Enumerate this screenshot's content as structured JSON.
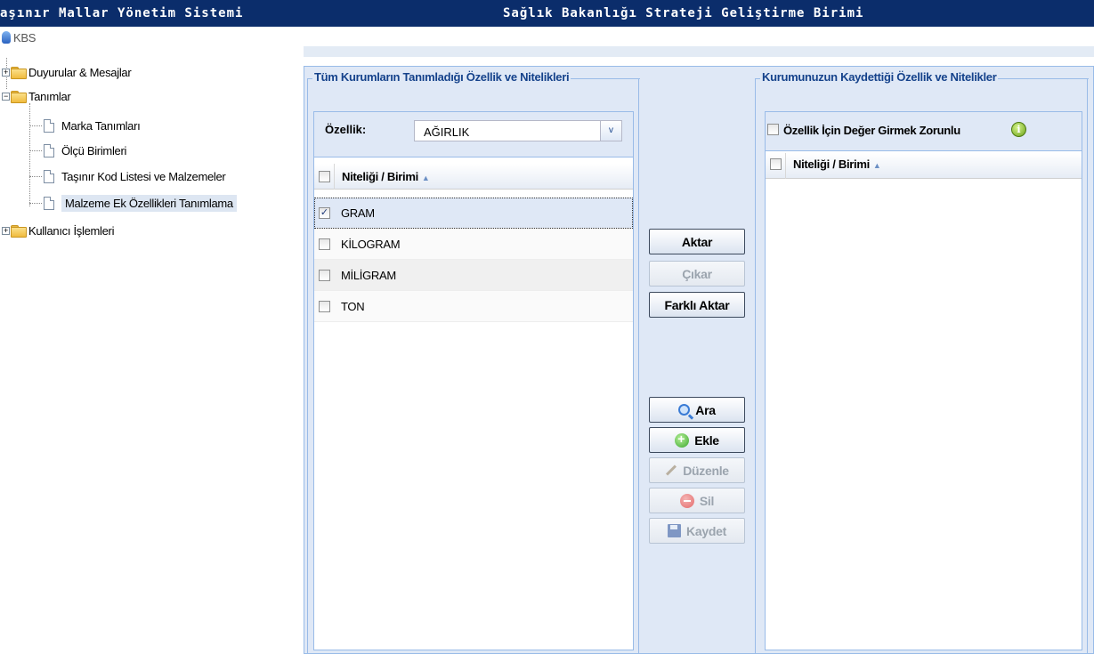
{
  "titlebar": {
    "app_title": "aşınır Mallar Yönetim Sistemi",
    "org_title": "Sağlık Bakanlığı Strateji Geliştirme Birimi"
  },
  "tree": {
    "root": "KBS",
    "duyurular": "Duyurular & Mesajlar",
    "tanimlar": "Tanımlar",
    "marka": "Marka Tanımları",
    "olcu": "Ölçü Birimleri",
    "tasinir": "Taşınır Kod Listesi ve Malzemeler",
    "malzeme_ek": "Malzeme Ek Özellikleri Tanımlama",
    "kullanici": "Kullanıcı İşlemleri",
    "expand_symbol": "+",
    "collapse_symbol": "−"
  },
  "left_panel": {
    "legend": "Tüm Kurumların Tanımladığı Özellik ve Nitelikleri",
    "ozellik_label": "Özellik:",
    "ozellik_value": "AĞIRLIK",
    "dropdown_arrow": "v",
    "column_header": "Niteliği / Birimi",
    "sort_arrow": "▲",
    "rows": [
      {
        "label": "GRAM",
        "checked": "✓"
      },
      {
        "label": "KİLOGRAM",
        "checked": ""
      },
      {
        "label": "MİLİGRAM",
        "checked": ""
      },
      {
        "label": "TON",
        "checked": ""
      }
    ]
  },
  "middle_buttons": {
    "aktar": "Aktar",
    "cikar": "Çıkar",
    "farkli_aktar": "Farklı Aktar",
    "ara": "Ara",
    "ekle": "Ekle",
    "duzenle": "Düzenle",
    "sil": "Sil",
    "kaydet": "Kaydet"
  },
  "right_panel": {
    "legend": "Kurumunuzun Kaydettiği Özellik ve Nitelikler",
    "zorunlu_label": "Özellik İçin Değer Girmek Zorunlu",
    "info_symbol": "i",
    "column_header": "Niteliği / Birimi",
    "sort_arrow": "▲"
  },
  "colors": {
    "titlebar": "#0b2d6b",
    "panel_bg": "#dfe8f6",
    "legend_text": "#15428b",
    "border": "#99bbe8"
  },
  "icons": {
    "kbs": "user-icon",
    "folder": "folder-icon",
    "document": "document-icon",
    "search": "magnifier-icon",
    "add": "plus-icon",
    "edit": "pencil-icon",
    "delete": "minus-icon",
    "save": "disk-icon",
    "info": "info-icon"
  }
}
